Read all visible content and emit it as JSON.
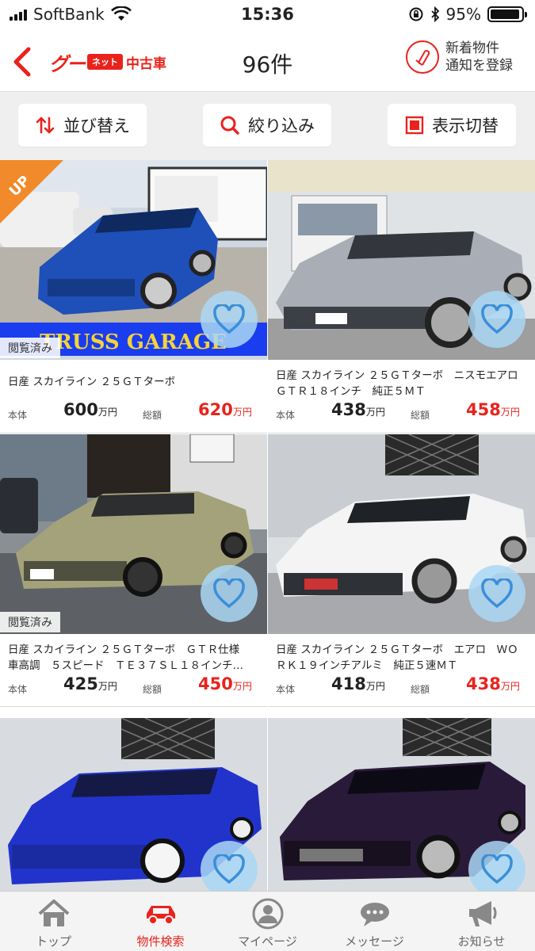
{
  "status_bar": {
    "carrier": "SoftBank",
    "time": "15:36",
    "battery": "95%",
    "battery_level": 0.95
  },
  "header": {
    "logo_gu": "グー",
    "logo_net": "ネット",
    "logo_used": "中古車",
    "count": "96件",
    "notify_line1": "新着物件",
    "notify_line2": "通知を登録"
  },
  "toolbar": {
    "sort_label": "並び替え",
    "filter_label": "絞り込み",
    "view_label": "表示切替"
  },
  "badges": {
    "up": "UP",
    "viewed": "閲覧済み"
  },
  "price_labels": {
    "body": "本体",
    "total": "総額",
    "unit": "万円"
  },
  "photo_texts": {
    "truss_banner": "TRUSS GARAGE"
  },
  "listings": [
    {
      "title": "日産 スカイライン ２５ＧＴターボ",
      "body_price": "600",
      "total_price": "620",
      "viewed": true,
      "up": true,
      "car_color": "#1f4fb8"
    },
    {
      "title": "日産 スカイライン ２５ＧＴターボ　ニスモエアロ　ＧＴＲ１８インチ　純正５ＭＴ",
      "body_price": "438",
      "total_price": "458",
      "viewed": false,
      "up": false,
      "car_color": "#9a9ea6"
    },
    {
      "title": "日産 スカイライン ２５ＧＴターボ　ＧＴＲ仕様　車高調　５スピード　ＴＥ３７ＳＬ１８インチ…",
      "body_price": "425",
      "total_price": "450",
      "viewed": true,
      "up": false,
      "car_color": "#9a9a6c"
    },
    {
      "title": "日産 スカイライン ２５ＧＴターボ　エアロ　ＷＯＲＫ１９インチアルミ　純正５速ＭＴ",
      "body_price": "418",
      "total_price": "438",
      "viewed": false,
      "up": false,
      "car_color": "#f2f2f2"
    },
    {
      "title": "",
      "body_price": "",
      "total_price": "",
      "viewed": false,
      "up": false,
      "car_color": "#2233cc"
    },
    {
      "title": "",
      "body_price": "",
      "total_price": "",
      "viewed": false,
      "up": false,
      "car_color": "#2a1a3a"
    }
  ],
  "tabbar": {
    "top": "トップ",
    "search": "物件検索",
    "mypage": "マイページ",
    "message": "メッセージ",
    "notice": "お知らせ"
  },
  "colors": {
    "accent": "#e8231c",
    "fav_bubble": "#aad7f5",
    "heart": "#3a8fd8"
  }
}
